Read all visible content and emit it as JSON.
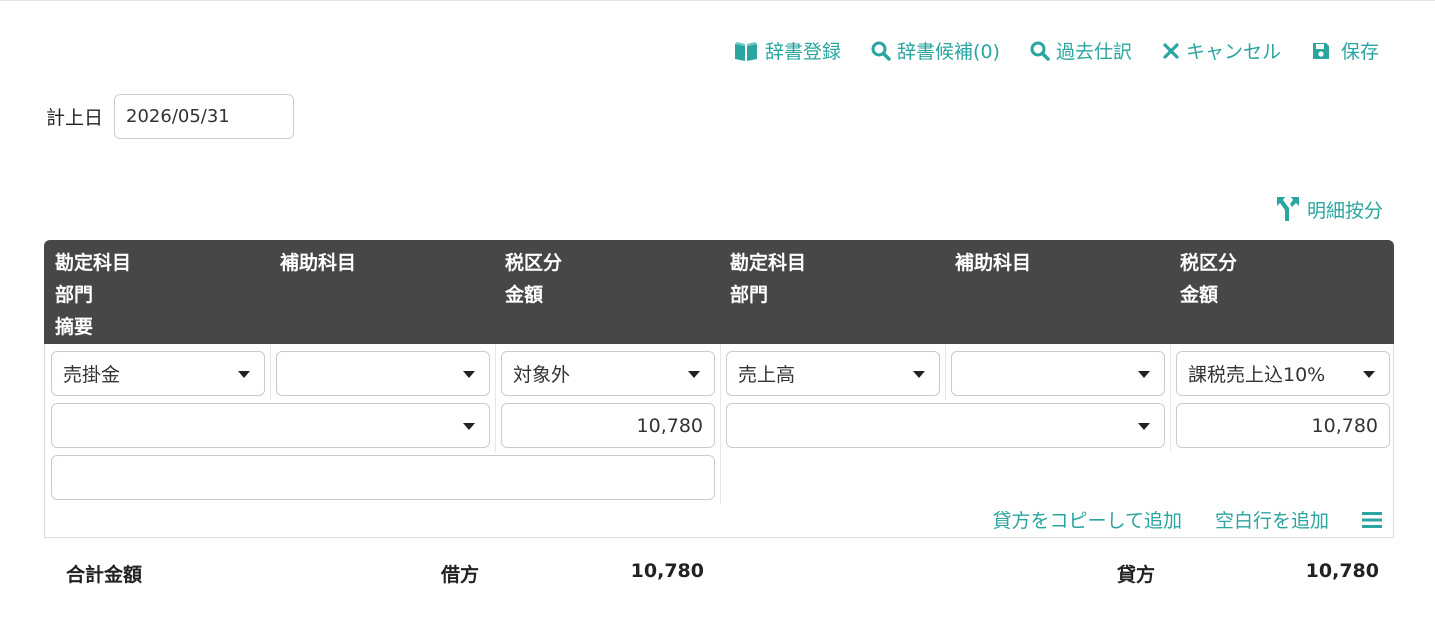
{
  "toolbar": {
    "dict_register": "辞書登録",
    "dict_candidates": "辞書候補(0)",
    "past_entries": "過去仕訳",
    "cancel": "キャンセル",
    "save": "保存"
  },
  "date": {
    "label": "計上日",
    "value": "2026/05/31"
  },
  "split_button": "明細按分",
  "header": {
    "debit_account": "勘定科目",
    "debit_dept": "部門",
    "debit_memo": "摘要",
    "debit_sub": "補助科目",
    "debit_tax": "税区分",
    "debit_amount": "金額",
    "credit_account": "勘定科目",
    "credit_dept": "部門",
    "credit_sub": "補助科目",
    "credit_tax": "税区分",
    "credit_amount": "金額"
  },
  "row": {
    "debit_account": "売掛金",
    "debit_sub": "",
    "debit_tax": "対象外",
    "debit_dept": "",
    "debit_amount": "10,780",
    "debit_memo": "",
    "credit_account": "売上高",
    "credit_sub": "",
    "credit_tax": "課税売上込10%",
    "credit_dept": "",
    "credit_amount": "10,780"
  },
  "row_actions": {
    "copy_credit": "貸方をコピーして追加",
    "add_blank": "空白行を追加"
  },
  "totals": {
    "label": "合計金額",
    "debit_label": "借方",
    "debit_value": "10,780",
    "credit_label": "貸方",
    "credit_value": "10,780"
  },
  "colors": {
    "accent": "#2aa5a0",
    "header_bg": "#474747"
  }
}
